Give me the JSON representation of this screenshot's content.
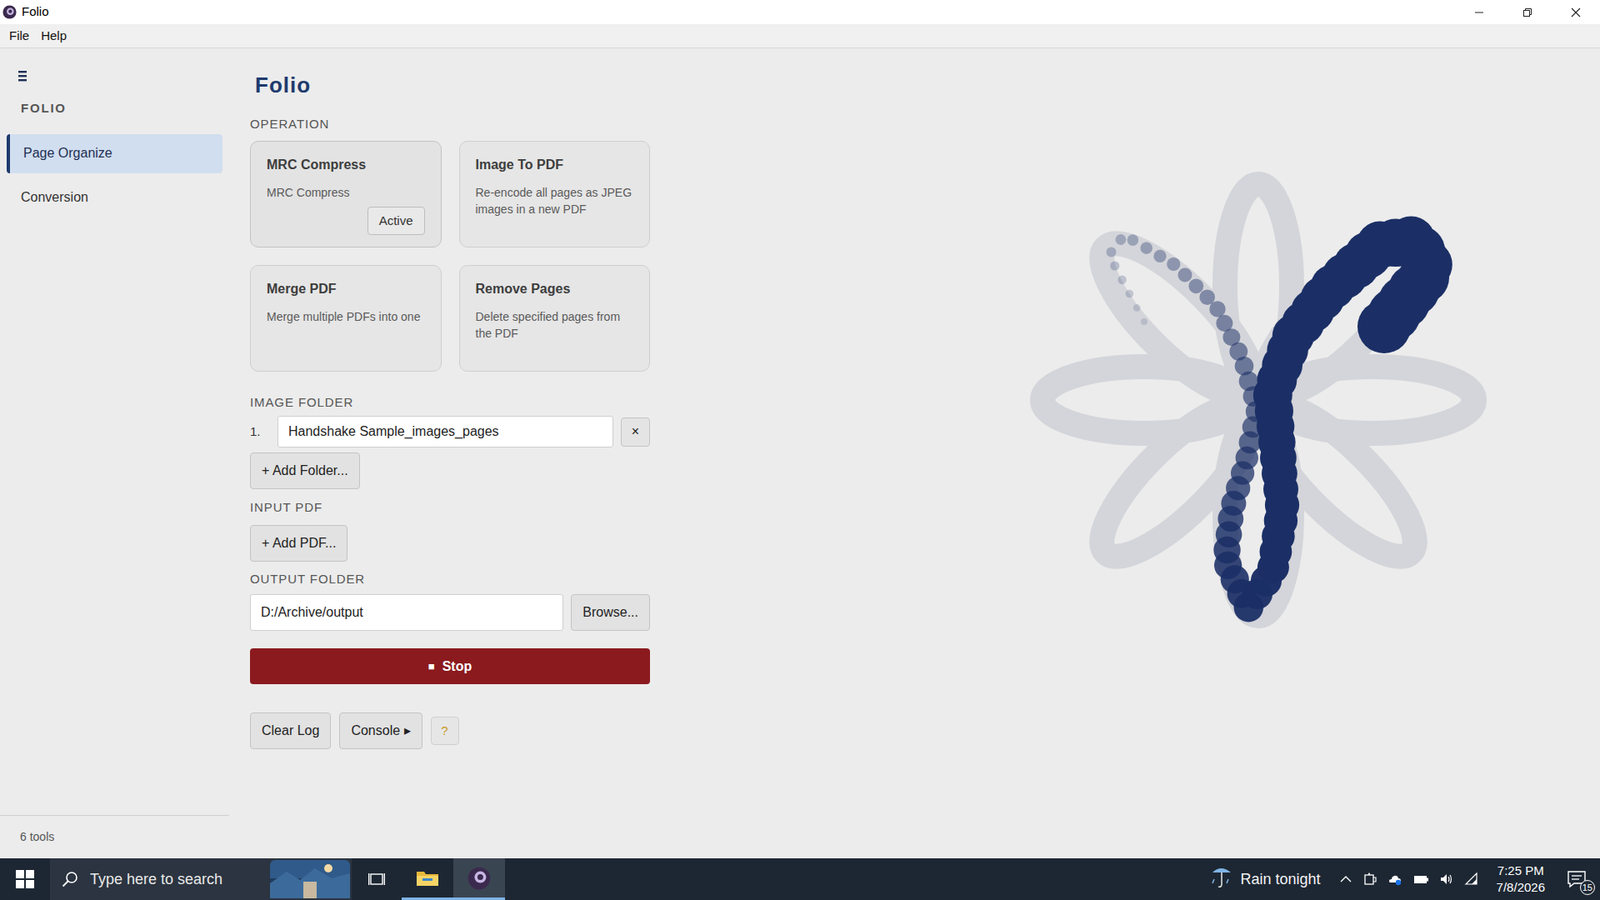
{
  "window": {
    "title": "Folio"
  },
  "menu": [
    "File",
    "Help"
  ],
  "sidebar": {
    "heading": "FOLIO",
    "items": [
      {
        "label": "Page Organize",
        "selected": true
      },
      {
        "label": "Conversion",
        "selected": false
      }
    ],
    "footer": "6 tools"
  },
  "main": {
    "title": "Folio",
    "operation_label": "OPERATION",
    "operations": [
      {
        "title": "MRC Compress",
        "description": "MRC Compress",
        "selected": true,
        "badge": "Active"
      },
      {
        "title": "Image To PDF",
        "description": "Re-encode all pages as JPEG images in a new PDF",
        "selected": false
      },
      {
        "title": "Merge PDF",
        "description": "Merge multiple PDFs into one",
        "selected": false
      },
      {
        "title": "Remove Pages",
        "description": "Delete specified pages from the PDF",
        "selected": false
      }
    ],
    "image_folder": {
      "label": "IMAGE FOLDER",
      "items": [
        {
          "index": "1.",
          "value": "Handshake Sample_images_pages",
          "remove": "×"
        }
      ],
      "add": "+ Add Folder..."
    },
    "input_pdf": {
      "label": "INPUT PDF",
      "add": "+ Add PDF..."
    },
    "output_folder": {
      "label": "OUTPUT FOLDER",
      "value": "D:/Archive/output",
      "browse": "Browse..."
    },
    "run_button": {
      "icon": "■",
      "label": "Stop",
      "running": true
    },
    "log_buttons": [
      "Clear Log",
      "Console ▸",
      "?"
    ]
  },
  "spinner": {
    "visible": true
  },
  "taskbar": {
    "search_placeholder": "Type here to search",
    "weather": "Rain tonight",
    "time": "7:25 PM",
    "date": "7/8/2026",
    "notifications": "15"
  }
}
